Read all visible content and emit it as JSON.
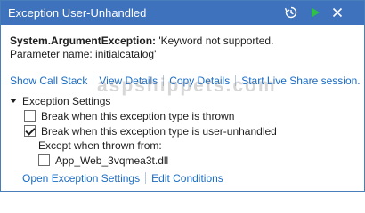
{
  "window": {
    "title": "Exception User-Unhandled",
    "icons": [
      "history-icon",
      "continue-play-icon",
      "close-icon"
    ],
    "titlebar_color": "#3f72bc"
  },
  "message": {
    "exception_type": "System.ArgumentException:",
    "exception_text": " 'Keyword not supported.",
    "parameter_line": "Parameter name: initialcatalog'"
  },
  "links": {
    "show_call_stack": "Show Call Stack",
    "view_details": "View Details",
    "copy_details": "Copy Details",
    "live_share": "Start Live Share session."
  },
  "settings": {
    "heading": "Exception Settings",
    "break_thrown": "Break when this exception type is thrown",
    "break_thrown_checked": false,
    "break_user_unhandled": "Break when this exception type is user-unhandled",
    "break_user_unhandled_checked": true,
    "except_label": "Except when thrown from:",
    "module": "App_Web_3vqmea3t.dll",
    "module_checked": false
  },
  "bottom_links": {
    "open_settings": "Open Exception Settings",
    "edit_conditions": "Edit Conditions"
  },
  "watermark": "aspsnippets.com",
  "link_color": "#1a6bc4"
}
